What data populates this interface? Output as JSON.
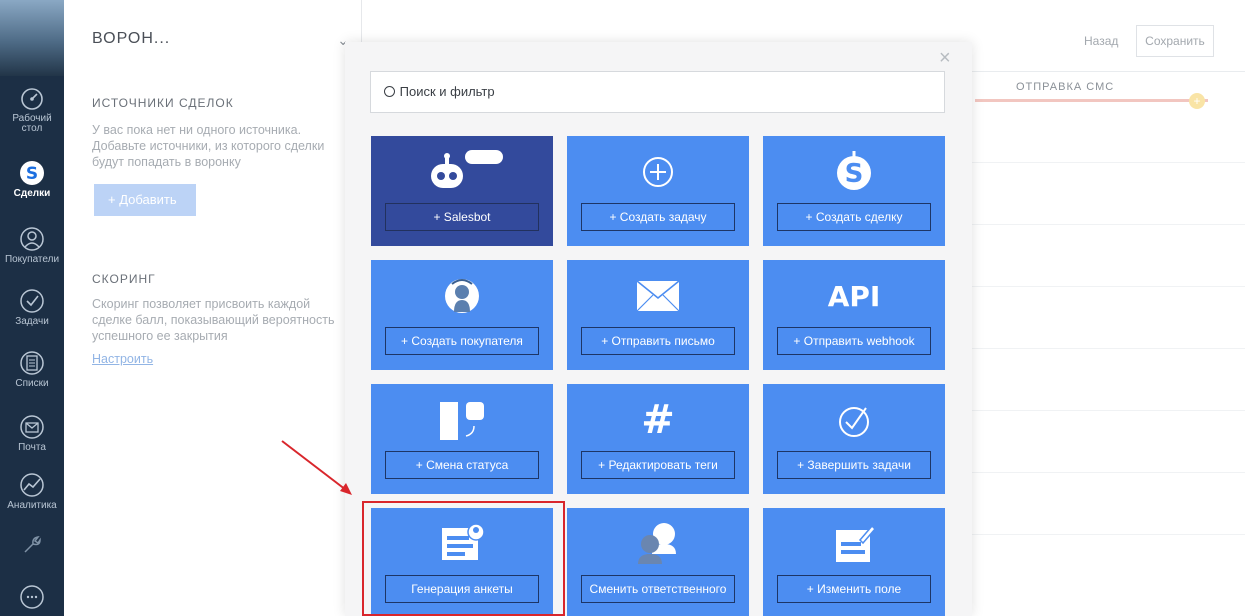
{
  "nav": {
    "items": [
      {
        "label": "Рабочий стол",
        "icon": "dashboard-icon"
      },
      {
        "label": "Сделки",
        "icon": "deals-icon",
        "active": true
      },
      {
        "label": "Покупатели",
        "icon": "customers-icon"
      },
      {
        "label": "Задачи",
        "icon": "tasks-icon"
      },
      {
        "label": "Списки",
        "icon": "lists-icon"
      },
      {
        "label": "Почта",
        "icon": "mail-icon"
      },
      {
        "label": "Аналитика",
        "icon": "analytics-icon"
      },
      {
        "label": "",
        "icon": "settings-icon"
      },
      {
        "label": "",
        "icon": "chat-icon"
      }
    ]
  },
  "panel": {
    "funnel_name": "ВОРОН...",
    "sources_title": "ИСТОЧНИКИ СДЕЛОК",
    "sources_text": "У вас пока нет ни одного источника. Добавьте источники, из которого сделки будут попадать в воронку",
    "add_label": "+ Добавить",
    "scoring_title": "СКОРИНГ",
    "scoring_text": "Скоринг позволяет присвоить каждой сделке балл, показывающий вероятность успешного ее закрытия",
    "scoring_link": "Настроить"
  },
  "header": {
    "back_label": "Назад",
    "save_label": "Сохранить"
  },
  "pipeline": {
    "column_title": "ОТПРАВКА СМС",
    "accent_color": "#f2c6c0"
  },
  "modal": {
    "close_glyph": "×",
    "search_placeholder": "Поиск и фильтр",
    "tiles": [
      {
        "label": "+ Salesbot",
        "icon": "robot-icon"
      },
      {
        "label": "+ Создать задачу",
        "icon": "plus-circle-icon"
      },
      {
        "label": "+ Создать сделку",
        "icon": "dollar-icon"
      },
      {
        "label": "+ Создать покупателя",
        "icon": "customer-icon"
      },
      {
        "label": "+ Отправить письмо",
        "icon": "envelope-icon"
      },
      {
        "label": "+ Отправить webhook",
        "icon": "api-icon",
        "icon_text": "API"
      },
      {
        "label": "+ Смена статуса",
        "icon": "status-change-icon"
      },
      {
        "label": "+ Редактировать теги",
        "icon": "hashtag-icon",
        "icon_text": "#"
      },
      {
        "label": "+ Завершить задачи",
        "icon": "check-circle-icon"
      },
      {
        "label": "Генерация анкеты",
        "icon": "form-generation-icon"
      },
      {
        "label": "Сменить ответственного",
        "icon": "change-owner-icon"
      },
      {
        "label": "+ Изменить поле",
        "icon": "edit-field-icon"
      }
    ],
    "colors": {
      "tile": "#4c8df1",
      "tile_dark": "#334a9c"
    }
  },
  "annotation": {
    "highlight_color": "#d9262c"
  }
}
